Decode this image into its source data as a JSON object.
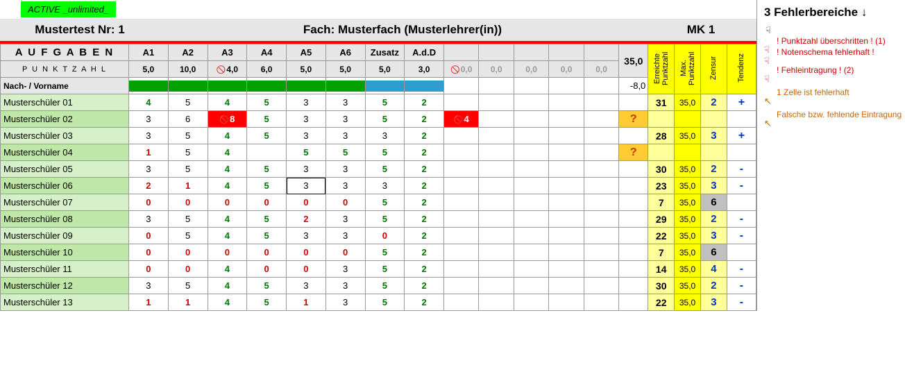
{
  "status_label": "ACTIVE _unlimited_",
  "title_left": "Mustertest Nr: 1",
  "title_mid": "Fach: Musterfach  (Musterlehrer(in))",
  "title_right": "MK 1",
  "hdr_aufgaben": "A U F G A B E N",
  "hdr_punktzahl": "P U N K T Z A H L",
  "hdr_name": "Nach- / Vorname",
  "tasks": [
    "A1",
    "A2",
    "A3",
    "A4",
    "A5",
    "A6",
    "Zusatz",
    "A.d.D"
  ],
  "pts": [
    "5,0",
    "10,0",
    "4,0",
    "6,0",
    "5,0",
    "5,0",
    "5,0",
    "3,0"
  ],
  "pts_err_idx": 2,
  "grey_pts": [
    "0,0",
    "0,0",
    "0,0",
    "0,0",
    "0,0"
  ],
  "grey_err_idx": 0,
  "sum_label": "35,0",
  "neg_label": "-8,0",
  "summ_hdr": [
    "Erreichte Punktzahl",
    "Max. Punktzahl",
    "Zensur",
    "Tendenz"
  ],
  "rows": [
    {
      "n": "Musterschüler 01",
      "c": [
        [
          "4",
          "g"
        ],
        [
          "5",
          "bk"
        ],
        [
          "4",
          "g"
        ],
        [
          "5",
          "g"
        ],
        [
          "3",
          "bk"
        ],
        [
          "3",
          "bk"
        ],
        [
          "5",
          "g"
        ],
        [
          "2",
          "g"
        ]
      ],
      "s": [
        "31",
        "35,0",
        "2",
        "+"
      ]
    },
    {
      "n": "Musterschüler 02",
      "c": [
        [
          "3",
          "bk"
        ],
        [
          "6",
          "bk"
        ],
        [
          "8",
          "bad"
        ],
        [
          "5",
          "g"
        ],
        [
          "3",
          "bk"
        ],
        [
          "3",
          "bk"
        ],
        [
          "5",
          "g"
        ],
        [
          "2",
          "g"
        ]
      ],
      "extra": [
        "4",
        "bad"
      ],
      "q": true,
      "s": [
        "",
        "",
        "",
        ""
      ]
    },
    {
      "n": "Musterschüler 03",
      "c": [
        [
          "3",
          "bk"
        ],
        [
          "5",
          "bk"
        ],
        [
          "4",
          "g"
        ],
        [
          "5",
          "g"
        ],
        [
          "3",
          "bk"
        ],
        [
          "3",
          "bk"
        ],
        [
          "3",
          "bk"
        ],
        [
          "2",
          "g"
        ]
      ],
      "s": [
        "28",
        "35,0",
        "3",
        "+"
      ]
    },
    {
      "n": "Musterschüler 04",
      "c": [
        [
          "1",
          "r"
        ],
        [
          "5",
          "bk"
        ],
        [
          "4",
          "g"
        ],
        [
          "",
          ""
        ],
        [
          "5",
          "g"
        ],
        [
          "5",
          "g"
        ],
        [
          "5",
          "g"
        ],
        [
          "2",
          "g"
        ]
      ],
      "q": true,
      "s": [
        "",
        "",
        "",
        ""
      ]
    },
    {
      "n": "Musterschüler 05",
      "c": [
        [
          "3",
          "bk"
        ],
        [
          "5",
          "bk"
        ],
        [
          "4",
          "g"
        ],
        [
          "5",
          "g"
        ],
        [
          "3",
          "bk"
        ],
        [
          "3",
          "bk"
        ],
        [
          "5",
          "g"
        ],
        [
          "2",
          "g"
        ]
      ],
      "s": [
        "30",
        "35,0",
        "2",
        "-"
      ]
    },
    {
      "n": "Musterschüler 06",
      "c": [
        [
          "2",
          "r"
        ],
        [
          "1",
          "r"
        ],
        [
          "4",
          "g"
        ],
        [
          "5",
          "g"
        ],
        [
          "3",
          "sel"
        ],
        [
          "3",
          "bk"
        ],
        [
          "3",
          "bk"
        ],
        [
          "2",
          "g"
        ]
      ],
      "s": [
        "23",
        "35,0",
        "3",
        "-"
      ]
    },
    {
      "n": "Musterschüler 07",
      "c": [
        [
          "0",
          "r"
        ],
        [
          "0",
          "r"
        ],
        [
          "0",
          "r"
        ],
        [
          "0",
          "r"
        ],
        [
          "0",
          "r"
        ],
        [
          "0",
          "r"
        ],
        [
          "5",
          "g"
        ],
        [
          "2",
          "g"
        ]
      ],
      "s": [
        "7",
        "35,0",
        "6",
        ""
      ],
      "grey": true
    },
    {
      "n": "Musterschüler 08",
      "c": [
        [
          "3",
          "bk"
        ],
        [
          "5",
          "bk"
        ],
        [
          "4",
          "g"
        ],
        [
          "5",
          "g"
        ],
        [
          "2",
          "r"
        ],
        [
          "3",
          "bk"
        ],
        [
          "5",
          "g"
        ],
        [
          "2",
          "g"
        ]
      ],
      "s": [
        "29",
        "35,0",
        "2",
        "-"
      ]
    },
    {
      "n": "Musterschüler 09",
      "c": [
        [
          "0",
          "r"
        ],
        [
          "5",
          "bk"
        ],
        [
          "4",
          "g"
        ],
        [
          "5",
          "g"
        ],
        [
          "3",
          "bk"
        ],
        [
          "3",
          "bk"
        ],
        [
          "0",
          "r"
        ],
        [
          "2",
          "g"
        ]
      ],
      "s": [
        "22",
        "35,0",
        "3",
        "-"
      ]
    },
    {
      "n": "Musterschüler 10",
      "c": [
        [
          "0",
          "r"
        ],
        [
          "0",
          "r"
        ],
        [
          "0",
          "r"
        ],
        [
          "0",
          "r"
        ],
        [
          "0",
          "r"
        ],
        [
          "0",
          "r"
        ],
        [
          "5",
          "g"
        ],
        [
          "2",
          "g"
        ]
      ],
      "s": [
        "7",
        "35,0",
        "6",
        ""
      ],
      "grey": true
    },
    {
      "n": "Musterschüler 11",
      "c": [
        [
          "0",
          "r"
        ],
        [
          "0",
          "r"
        ],
        [
          "4",
          "g"
        ],
        [
          "0",
          "r"
        ],
        [
          "0",
          "r"
        ],
        [
          "3",
          "bk"
        ],
        [
          "5",
          "g"
        ],
        [
          "2",
          "g"
        ]
      ],
      "s": [
        "14",
        "35,0",
        "4",
        "-"
      ]
    },
    {
      "n": "Musterschüler 12",
      "c": [
        [
          "3",
          "bk"
        ],
        [
          "5",
          "bk"
        ],
        [
          "4",
          "g"
        ],
        [
          "5",
          "g"
        ],
        [
          "3",
          "bk"
        ],
        [
          "3",
          "bk"
        ],
        [
          "5",
          "g"
        ],
        [
          "2",
          "g"
        ]
      ],
      "s": [
        "30",
        "35,0",
        "2",
        "-"
      ]
    },
    {
      "n": "Musterschüler 13",
      "c": [
        [
          "1",
          "r"
        ],
        [
          "1",
          "r"
        ],
        [
          "4",
          "g"
        ],
        [
          "5",
          "g"
        ],
        [
          "1",
          "r"
        ],
        [
          "3",
          "bk"
        ],
        [
          "5",
          "g"
        ],
        [
          "2",
          "g"
        ]
      ],
      "s": [
        "22",
        "35,0",
        "3",
        "-"
      ]
    }
  ],
  "side_title": "3 Fehlerbereiche ↓",
  "side_err1": "! Punktzahl überschritten ! (1)",
  "side_err2": "! Notenschema fehlerhaft !",
  "side_err3": "! Fehleintragung ! (2)",
  "side_info1": "1 Zelle ist fehlerhaft",
  "side_info2": "Falsche bzw. fehlende Eintragung",
  "hand": "☟",
  "cursor": "↖"
}
